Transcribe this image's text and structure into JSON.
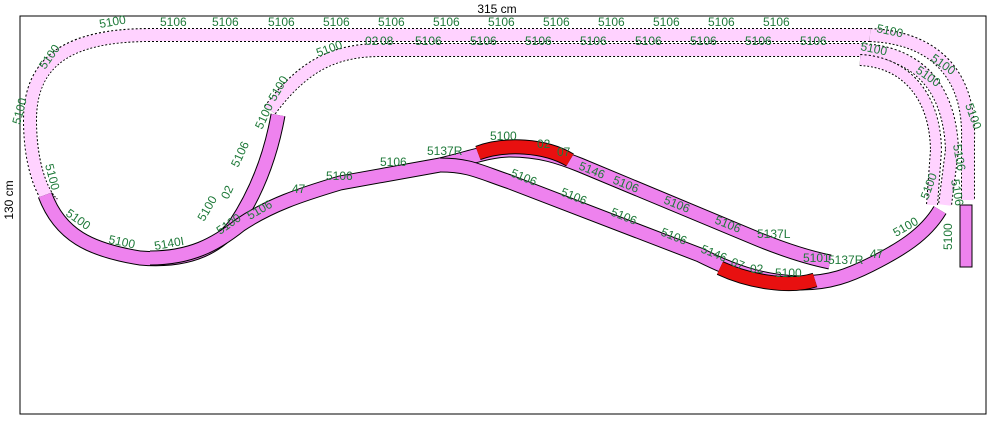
{
  "dimensions": {
    "width_label": "315 cm",
    "height_label": "130 cm"
  },
  "colors": {
    "track_fill": "#ee82ee",
    "hidden_track_fill": "#ffd2ff",
    "highlight_fill": "#e81010",
    "label_color": "#1f7a3a",
    "frame_color": "#000000"
  },
  "labels": [
    {
      "id": "t01",
      "text": "5100"
    },
    {
      "id": "t02",
      "text": "5106"
    },
    {
      "id": "t03",
      "text": "5106"
    },
    {
      "id": "t04",
      "text": "5106"
    },
    {
      "id": "t05",
      "text": "5106"
    },
    {
      "id": "t06",
      "text": "5106"
    },
    {
      "id": "t07",
      "text": "5106"
    },
    {
      "id": "t08",
      "text": "5106"
    },
    {
      "id": "t09",
      "text": "5106"
    },
    {
      "id": "t10",
      "text": "5106"
    },
    {
      "id": "t11",
      "text": "5106"
    },
    {
      "id": "t12",
      "text": "5106"
    },
    {
      "id": "t13",
      "text": "5106"
    },
    {
      "id": "t14",
      "text": "5100"
    },
    {
      "id": "t15",
      "text": "5100"
    },
    {
      "id": "t16",
      "text": "5100"
    },
    {
      "id": "t17",
      "text": "5100"
    },
    {
      "id": "t18",
      "text": "02"
    },
    {
      "id": "t19",
      "text": "08"
    },
    {
      "id": "t20",
      "text": "5106"
    },
    {
      "id": "t21",
      "text": "5106"
    },
    {
      "id": "t22",
      "text": "5106"
    },
    {
      "id": "t23",
      "text": "5106"
    },
    {
      "id": "t24",
      "text": "5106"
    },
    {
      "id": "t25",
      "text": "5106"
    },
    {
      "id": "t26",
      "text": "5106"
    },
    {
      "id": "t27",
      "text": "5106"
    },
    {
      "id": "t28",
      "text": "5100"
    },
    {
      "id": "t29",
      "text": "5100"
    },
    {
      "id": "t30",
      "text": "5100"
    },
    {
      "id": "t31",
      "text": "5100"
    },
    {
      "id": "t32",
      "text": "5100"
    },
    {
      "id": "t33",
      "text": "5100"
    },
    {
      "id": "t34",
      "text": "5100"
    },
    {
      "id": "t35",
      "text": "5100"
    },
    {
      "id": "t36",
      "text": "5106"
    },
    {
      "id": "t37",
      "text": "02"
    },
    {
      "id": "t38",
      "text": "5100"
    },
    {
      "id": "t39",
      "text": "5140I"
    },
    {
      "id": "t40",
      "text": "5100"
    },
    {
      "id": "t41",
      "text": "02"
    },
    {
      "id": "t42",
      "text": "5106"
    },
    {
      "id": "t43",
      "text": "47"
    },
    {
      "id": "t44",
      "text": "5106"
    },
    {
      "id": "t45",
      "text": "5106"
    },
    {
      "id": "t46",
      "text": "5137R"
    },
    {
      "id": "t47",
      "text": "5100"
    },
    {
      "id": "t48",
      "text": "02"
    },
    {
      "id": "t49",
      "text": "07"
    },
    {
      "id": "t50",
      "text": "5146"
    },
    {
      "id": "t51",
      "text": "5106"
    },
    {
      "id": "t52",
      "text": "5106"
    },
    {
      "id": "t53",
      "text": "5106"
    },
    {
      "id": "t54",
      "text": "5137L"
    },
    {
      "id": "t55",
      "text": "5106"
    },
    {
      "id": "t56",
      "text": "5106"
    },
    {
      "id": "t57",
      "text": "5106"
    },
    {
      "id": "t58",
      "text": "5106"
    },
    {
      "id": "t59",
      "text": "5106"
    },
    {
      "id": "t60",
      "text": "5146"
    },
    {
      "id": "t61",
      "text": "07"
    },
    {
      "id": "t62",
      "text": "02"
    },
    {
      "id": "t63",
      "text": "5100"
    },
    {
      "id": "t64",
      "text": "5101"
    },
    {
      "id": "t65",
      "text": "5137R"
    },
    {
      "id": "t66",
      "text": "47"
    },
    {
      "id": "t67",
      "text": "5100"
    },
    {
      "id": "t68",
      "text": "5100"
    },
    {
      "id": "t69",
      "text": "5106"
    },
    {
      "id": "t70",
      "text": "5106"
    },
    {
      "id": "t71",
      "text": "5100"
    },
    {
      "id": "t72",
      "text": "5100"
    }
  ]
}
